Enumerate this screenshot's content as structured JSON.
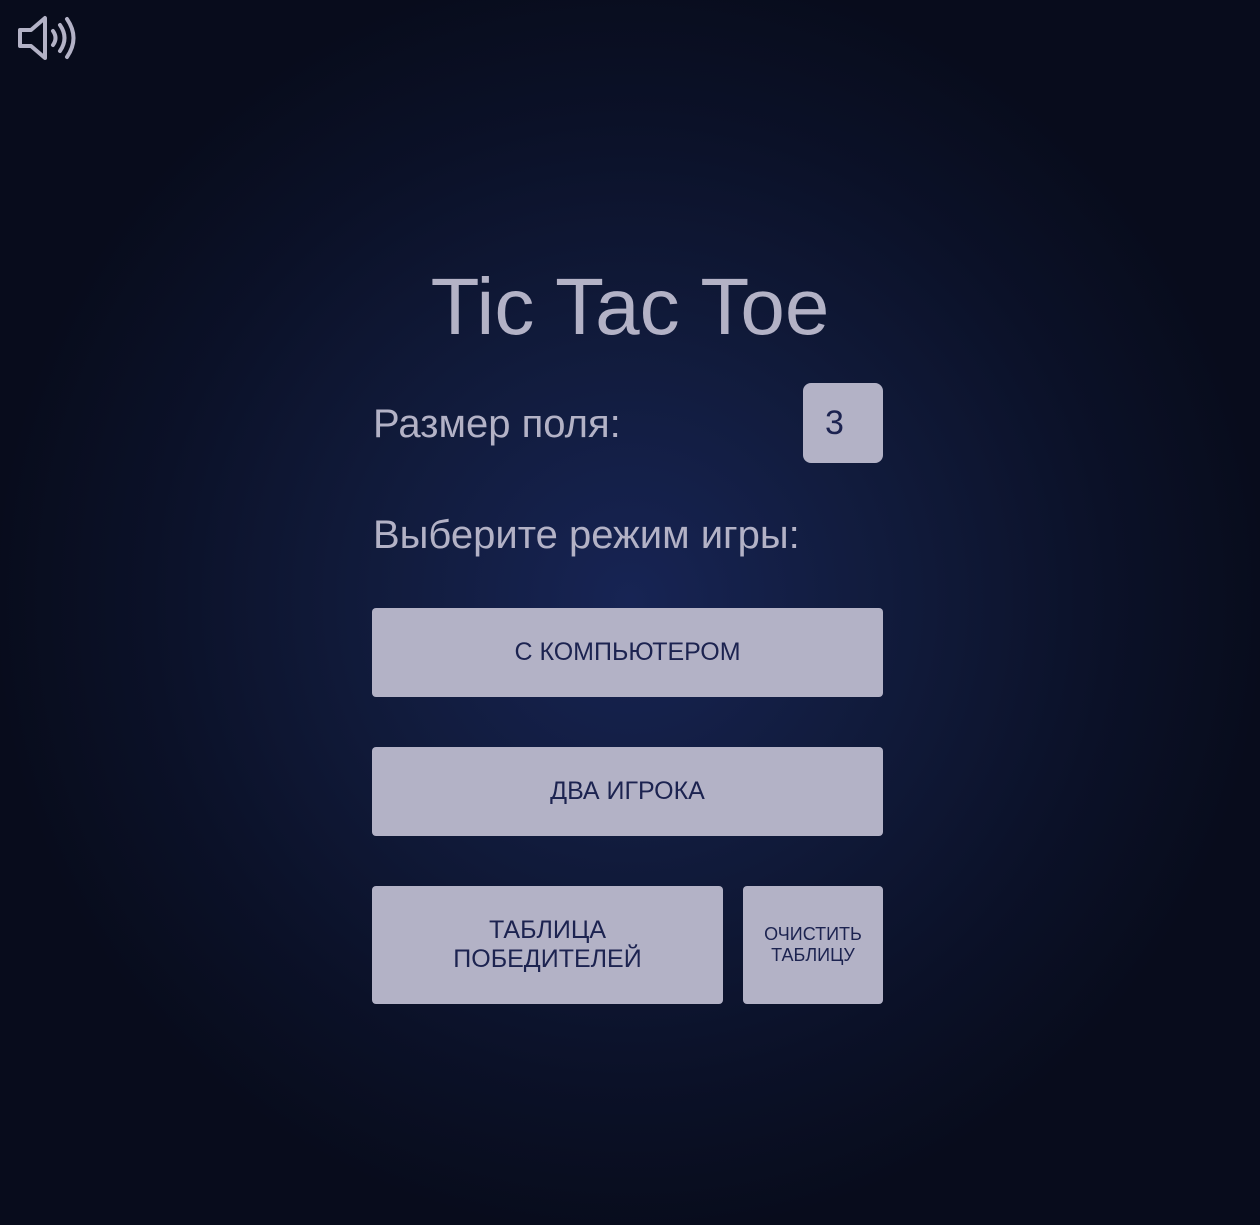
{
  "sound": {
    "icon": "speaker-on-icon",
    "state": "on"
  },
  "title": "Tic Tac Toe",
  "field_size": {
    "label": "Размер поля:",
    "value": "3"
  },
  "mode": {
    "label": "Выберите режим игры:"
  },
  "buttons": {
    "vs_computer": "С КОМПЬЮТЕРОМ",
    "two_players": "ДВА ИГРОКА",
    "leaderboard": {
      "line1": "ТАБЛИЦА",
      "line2": "ПОБЕДИТЕЛЕЙ"
    },
    "clear_table": {
      "line1": "ОЧИСТИТЬ",
      "line2": "ТАБЛИЦУ"
    }
  },
  "colors": {
    "background": "#111b3c",
    "text": "#b3b2c6",
    "button_bg": "#b3b2c6",
    "button_text": "#1c2350"
  }
}
